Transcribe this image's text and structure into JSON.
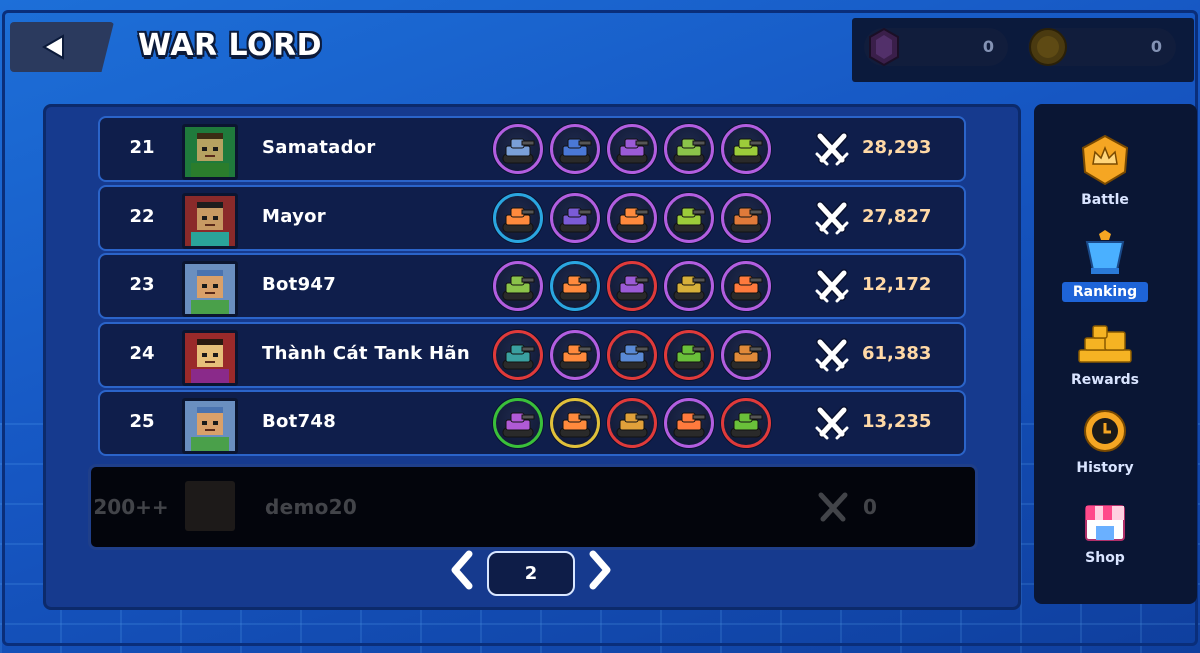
{
  "header": {
    "title": "WAR LORD"
  },
  "currency": {
    "gems": "0",
    "coins": "0"
  },
  "leaderboard": [
    {
      "rank": "21",
      "name": "Samatador",
      "score": "28,293",
      "avatar": {
        "skin": "#b6a261",
        "hair": "#3b2c14",
        "shirt": "#2b7d2c",
        "bg": "#1f7a3c"
      },
      "tanks": [
        {
          "rarity": "#b25ee0",
          "color": "#7aa0d8"
        },
        {
          "rarity": "#b25ee0",
          "color": "#4a78d6"
        },
        {
          "rarity": "#b25ee0",
          "color": "#9b5bd6"
        },
        {
          "rarity": "#b25ee0",
          "color": "#8bc34a"
        },
        {
          "rarity": "#b25ee0",
          "color": "#9ccc3a"
        }
      ]
    },
    {
      "rank": "22",
      "name": "Mayor",
      "score": "27,827",
      "avatar": {
        "skin": "#c79a63",
        "hair": "#1d1d1d",
        "shirt": "#2aa39a",
        "bg": "#8a2a2a"
      },
      "tanks": [
        {
          "rarity": "#2aa6e0",
          "color": "#ff8a3d"
        },
        {
          "rarity": "#b25ee0",
          "color": "#7b5bd6"
        },
        {
          "rarity": "#b25ee0",
          "color": "#ff8a3d"
        },
        {
          "rarity": "#b25ee0",
          "color": "#9ccc3a"
        },
        {
          "rarity": "#b25ee0",
          "color": "#e07a3a"
        }
      ]
    },
    {
      "rank": "23",
      "name": "Bot947",
      "score": "12,172",
      "avatar": {
        "skin": "#d9a06a",
        "hair": "#4a73b0",
        "shirt": "#4aa04a",
        "bg": "#6a8fc0"
      },
      "tanks": [
        {
          "rarity": "#b25ee0",
          "color": "#8bc34a"
        },
        {
          "rarity": "#2aa6e0",
          "color": "#ff8a3d"
        },
        {
          "rarity": "#e03a3a",
          "color": "#9b5bd6"
        },
        {
          "rarity": "#b25ee0",
          "color": "#d6b03a"
        },
        {
          "rarity": "#b25ee0",
          "color": "#ff7a3d"
        }
      ]
    },
    {
      "rank": "24",
      "name": "Thành Cát Tank Hãn",
      "score": "61,383",
      "avatar": {
        "skin": "#e6c07a",
        "hair": "#2a1a10",
        "shirt": "#8a2a8a",
        "bg": "#9a2a2a"
      },
      "tanks": [
        {
          "rarity": "#e03a3a",
          "color": "#3aa0a0"
        },
        {
          "rarity": "#b25ee0",
          "color": "#ff8a3d"
        },
        {
          "rarity": "#e03a3a",
          "color": "#5a8ad6"
        },
        {
          "rarity": "#e03a3a",
          "color": "#6ac03a"
        },
        {
          "rarity": "#b25ee0",
          "color": "#e08a3a"
        }
      ]
    },
    {
      "rank": "25",
      "name": "Bot748",
      "score": "13,235",
      "avatar": {
        "skin": "#d9a06a",
        "hair": "#4a73b0",
        "shirt": "#4aa04a",
        "bg": "#6a8fc0"
      },
      "tanks": [
        {
          "rarity": "#3ac03a",
          "color": "#b05ad6"
        },
        {
          "rarity": "#e0c03a",
          "color": "#ff8a3d"
        },
        {
          "rarity": "#e03a3a",
          "color": "#e0a03a"
        },
        {
          "rarity": "#b25ee0",
          "color": "#ff7a3d"
        },
        {
          "rarity": "#e03a3a",
          "color": "#6ac03a"
        }
      ]
    }
  ],
  "my_rank": {
    "rank": "200++",
    "name": "demo20",
    "score": "0"
  },
  "pager": {
    "page": "2"
  },
  "sidebar": {
    "items": [
      {
        "label": "Battle",
        "icon": "crown-shield-icon"
      },
      {
        "label": "Ranking",
        "icon": "trophy-icon"
      },
      {
        "label": "Rewards",
        "icon": "coin-stack-icon"
      },
      {
        "label": "History",
        "icon": "clock-icon"
      },
      {
        "label": "Shop",
        "icon": "shop-icon"
      }
    ]
  },
  "colors": {
    "accent": "#1e64d8",
    "score": "#ffd9a6",
    "panel": "#163a8e",
    "row": "#0f1e4b"
  }
}
